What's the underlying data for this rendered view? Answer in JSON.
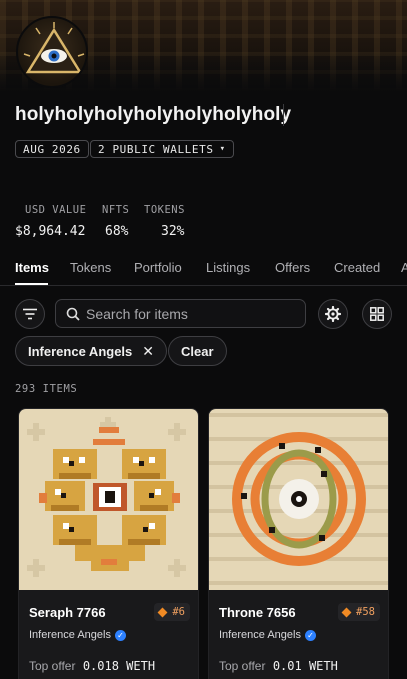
{
  "profile": {
    "name": "holyholyholyholyholyholyholy",
    "joined": "AUG 2026",
    "wallets": "2 PUBLIC WALLETS"
  },
  "stats": [
    {
      "label": "USD VALUE",
      "value": "$8,964.42"
    },
    {
      "label": "NFTS",
      "value": "68%"
    },
    {
      "label": "TOKENS",
      "value": "32%"
    }
  ],
  "tabs": [
    "Items",
    "Tokens",
    "Portfolio",
    "Listings",
    "Offers",
    "Created",
    "A"
  ],
  "active_tab": "Items",
  "toolbar": {
    "search_placeholder": "Search for items",
    "filter_icon": "filter-icon",
    "settings_icon": "gear-icon",
    "grid_icon": "grid-icon"
  },
  "filters": {
    "active": "Inference Angels",
    "clear_label": "Clear"
  },
  "item_count": "293 ITEMS",
  "items": [
    {
      "title": "Seraph 7766",
      "rank": "#6",
      "collection": "Inference Angels",
      "offer_label": "Top offer",
      "offer_value": "0.018 WETH"
    },
    {
      "title": "Throne 7656",
      "rank": "#58",
      "collection": "Inference Angels",
      "offer_label": "Top offer",
      "offer_value": "0.01 WETH"
    }
  ],
  "colors": {
    "accent_orange": "#f08a24",
    "verified_blue": "#2d81ff",
    "art_cream": "#e5d7b6",
    "art_gold": "#d7a441"
  }
}
